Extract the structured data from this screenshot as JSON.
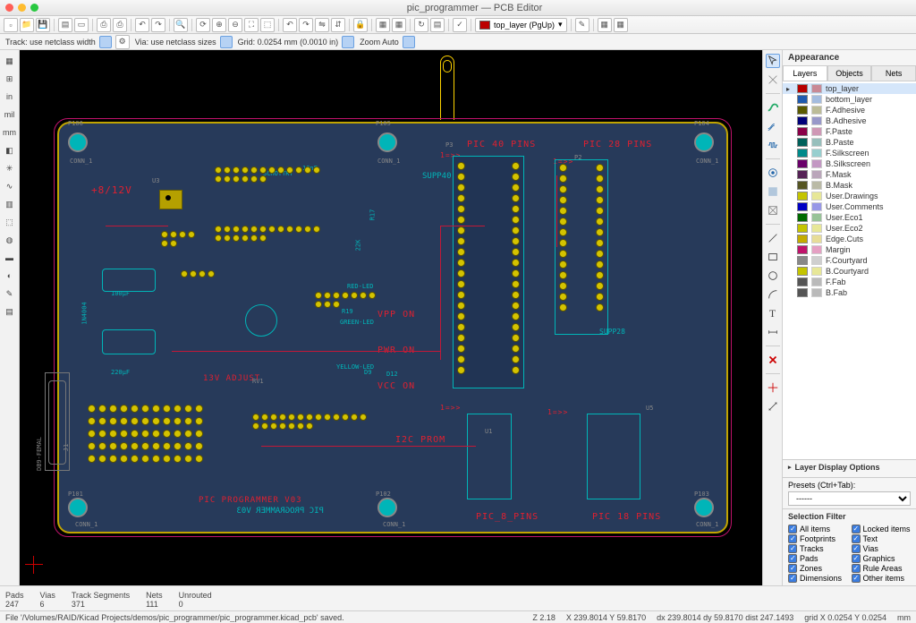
{
  "title": "pic_programmer — PCB Editor",
  "optbar": {
    "track_label": "Track: use netclass width",
    "via_label": "Via: use netclass sizes",
    "grid_label": "Grid: 0.0254 mm (0.0010 in)",
    "zoom_label": "Zoom Auto"
  },
  "top_layer_combo": "top_layer (PgUp)",
  "left_tools": [
    "▦",
    "⊞",
    "in",
    "mil",
    "mm",
    "◧",
    "⟲",
    "⟲",
    "▥",
    "⬚",
    "▤",
    "▥",
    "⟲",
    "✎",
    "⬚"
  ],
  "right_tools": [
    "arrow",
    "x",
    "wave",
    "wave2",
    "arc",
    "dim",
    "glyph",
    "hatch",
    "line",
    "rect",
    "circ",
    "arc2",
    "T",
    "txt",
    "eye",
    "plus",
    "stopx",
    "sheet",
    "qm"
  ],
  "layers": [
    {
      "name": "top_layer",
      "c": "#b80000",
      "sel": true
    },
    {
      "name": "bottom_layer",
      "c": "#1e5ab0"
    },
    {
      "name": "F.Adhesive",
      "c": "#5a5a00"
    },
    {
      "name": "B.Adhesive",
      "c": "#00007a"
    },
    {
      "name": "F.Paste",
      "c": "#8a0048"
    },
    {
      "name": "B.Paste",
      "c": "#00605a"
    },
    {
      "name": "F.Silkscreen",
      "c": "#008a8a"
    },
    {
      "name": "B.Silkscreen",
      "c": "#6a006a"
    },
    {
      "name": "F.Mask",
      "c": "#552255"
    },
    {
      "name": "B.Mask",
      "c": "#555522"
    },
    {
      "name": "User.Drawings",
      "c": "#c4c400"
    },
    {
      "name": "User.Comments",
      "c": "#0000c4"
    },
    {
      "name": "User.Eco1",
      "c": "#006a00"
    },
    {
      "name": "User.Eco2",
      "c": "#c4c400"
    },
    {
      "name": "Edge.Cuts",
      "c": "#c4ac00"
    },
    {
      "name": "Margin",
      "c": "#c0136b"
    },
    {
      "name": "F.Courtyard",
      "c": "#888888"
    },
    {
      "name": "B.Courtyard",
      "c": "#c4c400"
    },
    {
      "name": "F.Fab",
      "c": "#555555"
    },
    {
      "name": "B.Fab",
      "c": "#555555"
    }
  ],
  "panel": {
    "appearance": "Appearance",
    "tab_layers": "Layers",
    "tab_objects": "Objects",
    "tab_nets": "Nets",
    "layer_disp": "Layer Display Options",
    "presets_l": "Presets (Ctrl+Tab):",
    "presets_v": "------",
    "sel_filter": "Selection Filter",
    "filters_l": [
      "All items",
      "Footprints",
      "Tracks",
      "Pads",
      "Zones",
      "Dimensions"
    ],
    "filters_r": [
      "Locked items",
      "Text",
      "Vias",
      "Graphics",
      "Rule Areas",
      "Other items"
    ]
  },
  "stats": {
    "pads_l": "Pads",
    "pads_v": "247",
    "vias_l": "Vias",
    "vias_v": "6",
    "trk_l": "Track Segments",
    "trk_v": "371",
    "nets_l": "Nets",
    "nets_v": "111",
    "unr_l": "Unrouted",
    "unr_v": "0"
  },
  "status": {
    "file": "File '/Volumes/RAID/Kicad Projects/demos/pic_programmer/pic_programmer.kicad_pcb' saved.",
    "z": "Z 2.18",
    "xy": "X 239.8014   Y 59.8170",
    "dxy": "dx 239.8014  dy 59.8170  dist 247.1493",
    "grid": "grid X 0.0254   Y 0.0254",
    "unit": "mm"
  },
  "board": {
    "p8v": "+8/12V",
    "conn1": "CONN_1",
    "p105": "P105",
    "p106": "P106",
    "p104": "P104",
    "p101": "P101",
    "p102": "P102",
    "p103": "P103",
    "pic40": "PIC 40 PINS",
    "pic28": "PIC 28 PINS",
    "pic8": "PIC_8_PINS",
    "pic18": "PIC 18 PINS",
    "supp40": "SUPP40",
    "supp28": "SUPP28",
    "p3": "P3",
    "p2": "P2",
    "u5": "U5",
    "u1": "U1",
    "u3": "U3",
    "rv1": "RV1",
    "j1": "J1",
    "vppon": "VPP ON",
    "pwron": "PWR ON",
    "vccon": "VCC ON",
    "redled": "RED-LED",
    "greenled": "GREEN-LED",
    "yellowled": "YELLOW-LED",
    "adj": "13V ADJUST",
    "schottky": "SCHOTTKY",
    "db9": "DB9-FEMAL",
    "i2c": "I2C PROM",
    "prog1": "PIC PROGRAMMER V03",
    "prog2": "PIC PROGRAMMER V03",
    "one": "1=>>",
    "one2": "1=>>",
    "one3": "1=>>",
    "one4": "1=>>",
    "d12": "D12",
    "d9": "D9",
    "r19": "R19",
    "r17": "R17",
    "c100": "100µF",
    "c220": "220µF",
    "c10n": "10nF",
    "r22k": "22K",
    "n1n4004": "1N4004"
  }
}
